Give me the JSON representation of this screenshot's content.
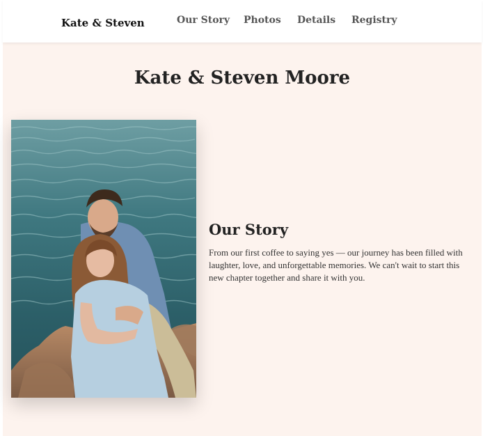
{
  "nav": {
    "brand": "Kate & Steven",
    "links": [
      {
        "label": "Our Story"
      },
      {
        "label": "Photos"
      },
      {
        "label": "Details"
      },
      {
        "label": "Registry"
      }
    ]
  },
  "hero": {
    "title": "Kate & Steven Moore"
  },
  "story": {
    "heading": "Our Story",
    "body": "From our first coffee to saying yes — our journey has been filled with laughter, love, and unforgettable memories. We can't wait to start this new chapter together and share it with you."
  },
  "photo": {
    "alt": "Couple sitting on rocks by the sea"
  },
  "colors": {
    "page_background": "#fdf3ee",
    "nav_background": "#ffffff",
    "heading_text": "#222222",
    "nav_text": "#555555",
    "sea": "#2d6670"
  }
}
